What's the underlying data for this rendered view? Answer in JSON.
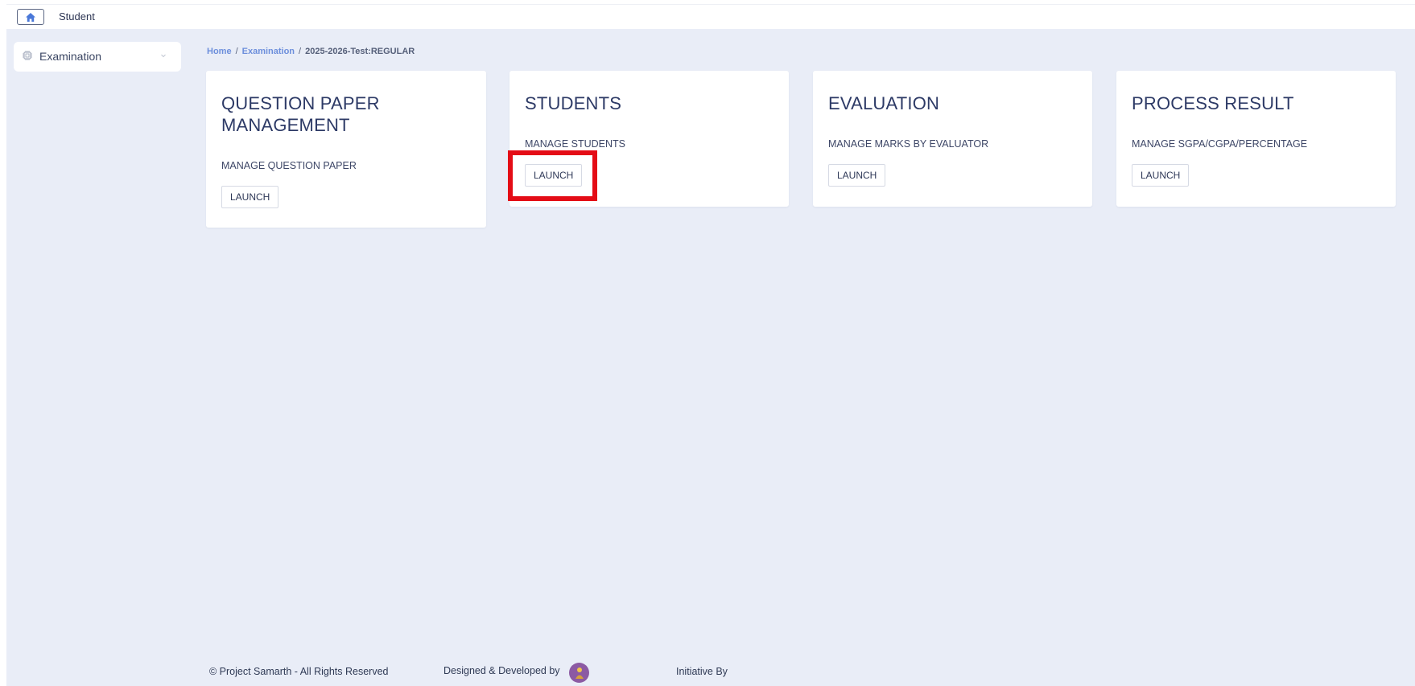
{
  "topbar": {
    "title": "Student"
  },
  "sidebar": {
    "items": [
      {
        "label": "Examination"
      }
    ]
  },
  "breadcrumb": {
    "items": [
      {
        "label": "Home",
        "link": true
      },
      {
        "label": "Examination",
        "link": true
      },
      {
        "label": "2025-2026-Test:REGULAR",
        "link": false
      }
    ],
    "separator": "/"
  },
  "cards": [
    {
      "title_line1": "QUESTION PAPER",
      "title_line2": "MANAGEMENT",
      "subtitle": "MANAGE QUESTION PAPER",
      "button": "LAUNCH"
    },
    {
      "title_line1": "STUDENTS",
      "subtitle": "MANAGE STUDENTS",
      "button": "LAUNCH"
    },
    {
      "title_line1": "EVALUATION",
      "subtitle": "MANAGE MARKS BY EVALUATOR",
      "button": "LAUNCH"
    },
    {
      "title_line1": "PROCESS RESULT",
      "subtitle": "MANAGE SGPA/CGPA/PERCENTAGE",
      "button": "LAUNCH"
    }
  ],
  "footer": {
    "copyright": "© Project Samarth - All Rights Reserved",
    "designed_by": "Designed & Developed by",
    "initiative_by": "Initiative By"
  },
  "colors": {
    "content_bg": "#e9edf7",
    "accent_link": "#6d8fdc",
    "highlight": "#e40c16",
    "title_text": "#2d3a66"
  },
  "icons": {
    "home": "home-icon",
    "sidebar": "chip-icon",
    "chevron": "chevron-down-icon",
    "logo": "developer-logo-icon"
  }
}
